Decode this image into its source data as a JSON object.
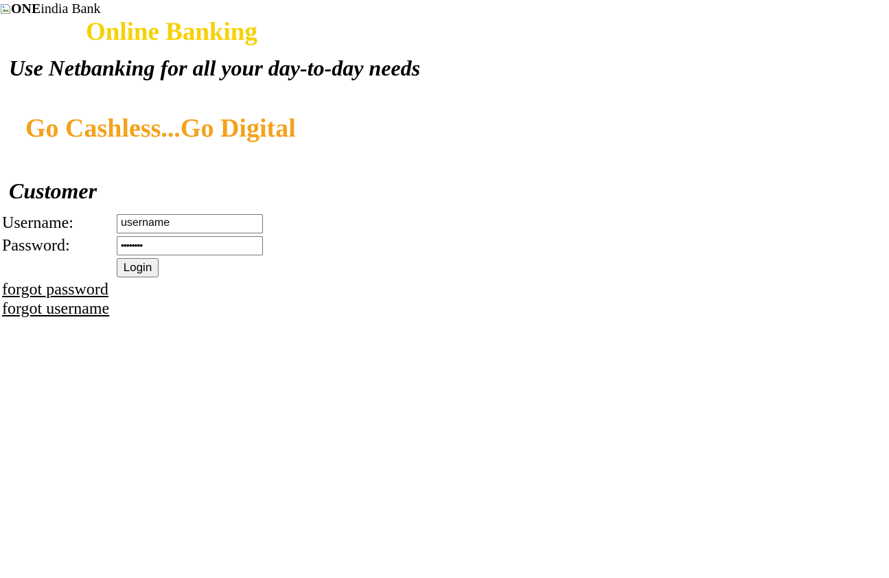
{
  "header": {
    "logo_bold": "ONE",
    "logo_rest": "india Bank",
    "title": "Online Banking"
  },
  "tagline": "Use Netbanking for all your day-to-day needs",
  "promo": "Go Cashless...Go Digital",
  "customer": {
    "heading": "Customer",
    "username_label": "Username:",
    "username_value": "username",
    "password_label": "Password:",
    "password_value": "••••••••",
    "login_label": "Login"
  },
  "links": {
    "forgot_password": "forgot password",
    "forgot_username": "forgot username"
  },
  "colors": {
    "title": "#f6d104",
    "promo": "#f4a21c",
    "button_bg": "#efefef",
    "field_border": "#767676"
  },
  "icons": {
    "logo": "broken-image-icon"
  }
}
